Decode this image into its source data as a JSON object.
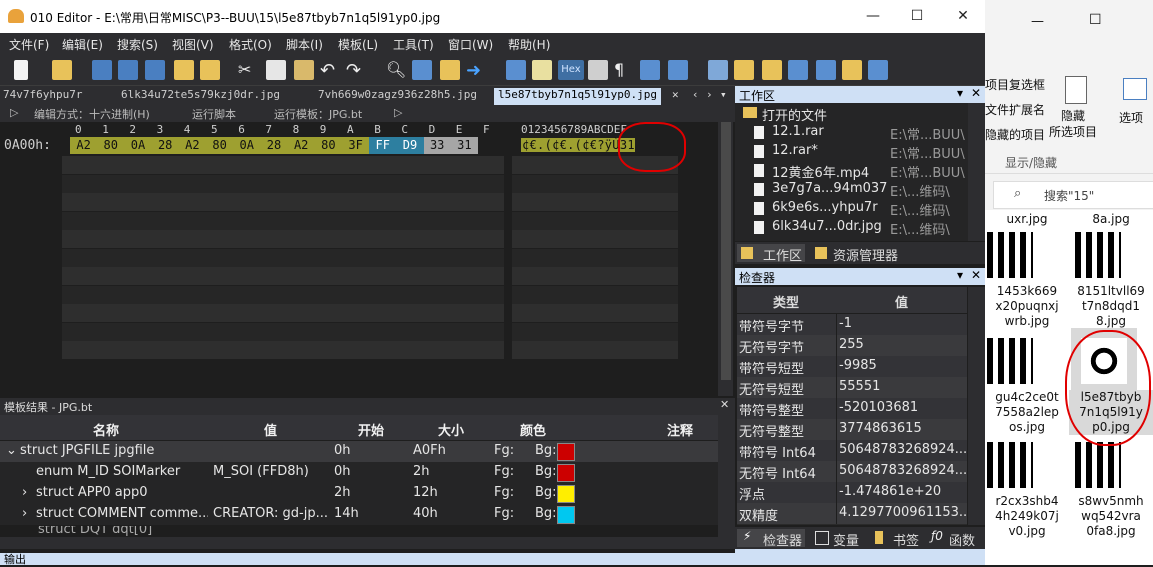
{
  "window": {
    "title": "010 Editor - E:\\常用\\日常MISC\\P3--BUU\\15\\l5e87tbyb7n1q5l91yp0.jpg",
    "minimize": "—",
    "maximize": "☐",
    "close": "✕"
  },
  "menu": [
    "文件(F)",
    "编辑(E)",
    "搜索(S)",
    "视图(V)",
    "格式(O)",
    "脚本(I)",
    "模板(L)",
    "工具(T)",
    "窗口(W)",
    "帮助(H)"
  ],
  "toolbar": {
    "hex_label": "Hex"
  },
  "tabs": [
    "74v7f6yhpu7r",
    "6lk34u72te5s79kzj0dr.jpg",
    "7vh669w0zagz936z28h5.jpg",
    "l5e87tbyb7n1q5l91yp0.jpg"
  ],
  "tab_close": "✕",
  "editor_header": {
    "edit_mode": "编辑方式：十六进制(H)",
    "run_script": "运行脚本",
    "run_template": "运行模板：JPG.bt",
    "arrow": "▷"
  },
  "hex": {
    "col_headers": [
      "0",
      "1",
      "2",
      "3",
      "4",
      "5",
      "6",
      "7",
      "8",
      "9",
      "A",
      "B",
      "C",
      "D",
      "E",
      "F"
    ],
    "ascii_header": "0123456789ABCDEF",
    "row_offset": "0A00h:",
    "bytes": [
      "A2",
      "80",
      "0A",
      "28",
      "A2",
      "80",
      "0A",
      "28",
      "A2",
      "80",
      "3F",
      "FF",
      "D9",
      "33",
      "31"
    ],
    "ascii": "¢€.(¢€.(¢€?ÿÙ31"
  },
  "template": {
    "header": "模板结果 - JPG.bt",
    "columns": [
      "名称",
      "值",
      "开始",
      "大小",
      "颜色",
      "注释"
    ],
    "rows": [
      {
        "name": "struct JPGFILE jpgfile",
        "value": "",
        "start": "0h",
        "size": "A0Fh",
        "fg": "Fg:",
        "bg": "Bg:",
        "bg_color": "#cc0000",
        "expand": "⌄"
      },
      {
        "name": "enum M_ID SOIMarker",
        "value": "M_SOI (FFD8h)",
        "start": "0h",
        "size": "2h",
        "fg": "Fg:",
        "bg": "Bg:",
        "bg_color": "#cc0000",
        "expand": ""
      },
      {
        "name": "struct APP0 app0",
        "value": "",
        "start": "2h",
        "size": "12h",
        "fg": "Fg:",
        "bg": "Bg:",
        "bg_color": "#ffee00",
        "expand": "›"
      },
      {
        "name": "struct COMMENT comme...",
        "value": "CREATOR: gd-jp...",
        "start": "14h",
        "size": "40h",
        "fg": "Fg:",
        "bg": "Bg:",
        "bg_color": "#00c8f0",
        "expand": "›"
      }
    ],
    "partial_row": "struct DQT dqt[0]"
  },
  "output_header": "输出",
  "workspace": {
    "header": "工作区",
    "folder": "打开的文件",
    "files": [
      {
        "name": "12.1.rar",
        "path": "E:\\常...BUU\\"
      },
      {
        "name": "12.rar*",
        "path": "E:\\常...BUU\\"
      },
      {
        "name": "12黄金6年.mp4",
        "path": "E:\\常...BUU\\"
      },
      {
        "name": "3e7g7a...94m037",
        "path": "E:\\...维码\\"
      },
      {
        "name": "6k9e6s...yhpu7r",
        "path": "E:\\...维码\\"
      },
      {
        "name": "6lk34u7...0dr.jpg",
        "path": "E:\\...维码\\"
      }
    ],
    "tab_workspace": "工作区",
    "tab_explorer": "资源管理器"
  },
  "inspector": {
    "header": "检查器",
    "col_type": "类型",
    "col_value": "值",
    "rows": [
      {
        "type": "带符号字节",
        "value": "-1"
      },
      {
        "type": "无符号字节",
        "value": "255"
      },
      {
        "type": "带符号短型",
        "value": "-9985"
      },
      {
        "type": "无符号短型",
        "value": "55551"
      },
      {
        "type": "带符号整型",
        "value": "-520103681"
      },
      {
        "type": "无符号整型",
        "value": "3774863615"
      },
      {
        "type": "带符号 Int64",
        "value": "50648783268924..."
      },
      {
        "type": "无符号 Int64",
        "value": "50648783268924..."
      },
      {
        "type": "浮点",
        "value": "-1.474861e+20"
      },
      {
        "type": "双精度",
        "value": "4.1297700961153..."
      }
    ],
    "tabs": [
      "检查器",
      "变量",
      "书签",
      "函数"
    ]
  },
  "explorer": {
    "ribbon": [
      "项目复选框",
      "文件扩展名",
      "隐藏的项目"
    ],
    "hide_btn": "隐藏\n所选项目",
    "options": "选项",
    "group": "显示/隐藏",
    "search_placeholder": "搜索\"15\"",
    "files": [
      {
        "name": "uxr.jpg"
      },
      {
        "name": "8a.jpg"
      },
      {
        "name": "1453k669\nx20puqnxj\nwrb.jpg"
      },
      {
        "name": "8151ltvll69\nt7n8dqd1\n8.jpg"
      },
      {
        "name": "gu4c2ce0t\n7558a2lep\nos.jpg"
      },
      {
        "name": "l5e87tbyb\n7n1q5l91y\np0.jpg"
      },
      {
        "name": "r2cx3shb4\n4h249k07j\nv0.jpg"
      },
      {
        "name": "s8wv5nmh\nwq542vra\n0fa8.jpg"
      }
    ],
    "min": "—",
    "max": "☐"
  },
  "colors": {
    "accent": "#cfe0f5",
    "annotation": "#e00000",
    "byte_olive": "#9ea030",
    "byte_teal": "#2d7fa0",
    "byte_grey": "#a6a6a6"
  }
}
